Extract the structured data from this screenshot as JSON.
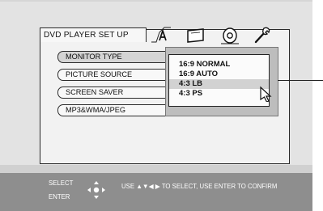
{
  "panel": {
    "title": "DVD PLAYER SET UP"
  },
  "tabs": [
    {
      "icon": "letter-a-icon"
    },
    {
      "icon": "display-icon"
    },
    {
      "icon": "speaker-icon"
    },
    {
      "icon": "wrench-icon"
    }
  ],
  "menu": {
    "items": [
      {
        "label": "MONITOR TYPE"
      },
      {
        "label": "PICTURE SOURCE"
      },
      {
        "label": "SCREEN SAVER"
      },
      {
        "label": "MP3&WMA/JPEG"
      }
    ]
  },
  "dropdown": {
    "options": [
      {
        "label": "16:9 NORMAL"
      },
      {
        "label": "16:9 AUTO"
      },
      {
        "label": "4:3 LB"
      },
      {
        "label": "4:3 PS"
      }
    ],
    "selected_index": 2
  },
  "footer": {
    "select_label": "SELECT",
    "enter_label": "ENTER",
    "help_text": "USE ▲▼◀ ▶ TO SELECT, USE ENTER TO CONFIRM"
  }
}
